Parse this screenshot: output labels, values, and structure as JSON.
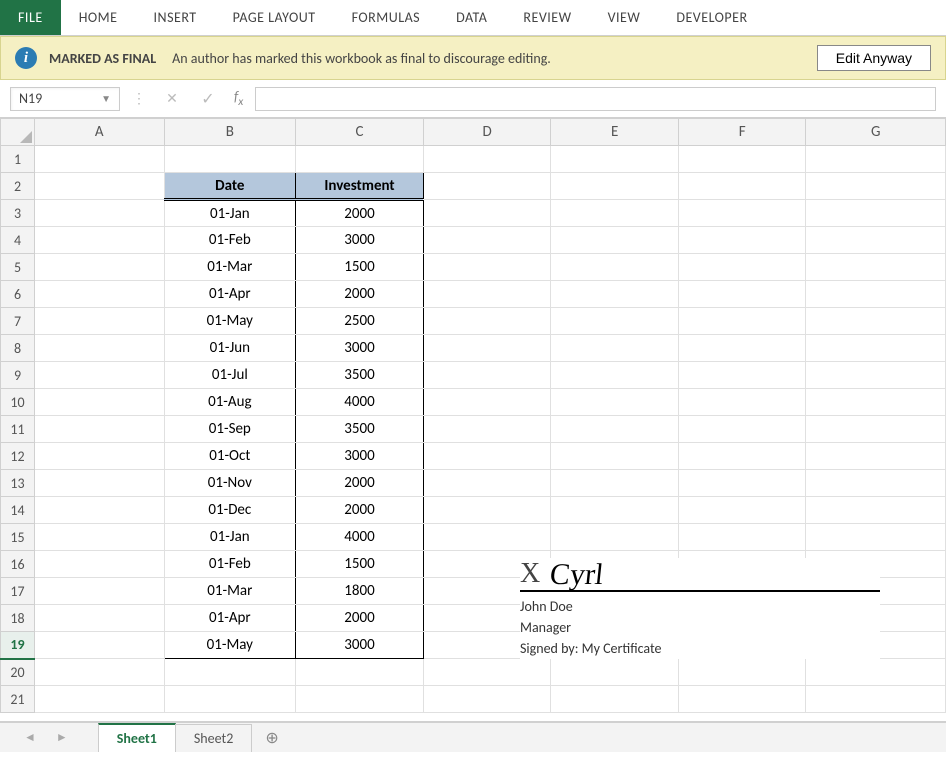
{
  "ribbon": {
    "tabs": [
      "FILE",
      "HOME",
      "INSERT",
      "PAGE LAYOUT",
      "FORMULAS",
      "DATA",
      "REVIEW",
      "VIEW",
      "DEVELOPER"
    ]
  },
  "final_bar": {
    "title": "MARKED AS FINAL",
    "message": "An author has marked this workbook as final to discourage editing.",
    "button": "Edit Anyway"
  },
  "name_box": "N19",
  "formula_bar": "",
  "columns": [
    "A",
    "B",
    "C",
    "D",
    "E",
    "F",
    "G"
  ],
  "row_count": 21,
  "selected_row": 19,
  "table": {
    "header": {
      "b": "Date",
      "c": "Investment"
    },
    "rows": [
      {
        "b": "01-Jan",
        "c": "2000"
      },
      {
        "b": "01-Feb",
        "c": "3000"
      },
      {
        "b": "01-Mar",
        "c": "1500"
      },
      {
        "b": "01-Apr",
        "c": "2000"
      },
      {
        "b": "01-May",
        "c": "2500"
      },
      {
        "b": "01-Jun",
        "c": "3000"
      },
      {
        "b": "01-Jul",
        "c": "3500"
      },
      {
        "b": "01-Aug",
        "c": "4000"
      },
      {
        "b": "01-Sep",
        "c": "3500"
      },
      {
        "b": "01-Oct",
        "c": "3000"
      },
      {
        "b": "01-Nov",
        "c": "2000"
      },
      {
        "b": "01-Dec",
        "c": "2000"
      },
      {
        "b": "01-Jan",
        "c": "4000"
      },
      {
        "b": "01-Feb",
        "c": "1500"
      },
      {
        "b": "01-Mar",
        "c": "1800"
      },
      {
        "b": "01-Apr",
        "c": "2000"
      },
      {
        "b": "01-May",
        "c": "3000"
      }
    ]
  },
  "signature": {
    "x": "X",
    "scribble": "Cyrl",
    "name": "John Doe",
    "role": "Manager",
    "signed_by": "Signed by: My Certificate"
  },
  "sheets": {
    "active": "Sheet1",
    "tabs": [
      "Sheet1",
      "Sheet2"
    ]
  }
}
